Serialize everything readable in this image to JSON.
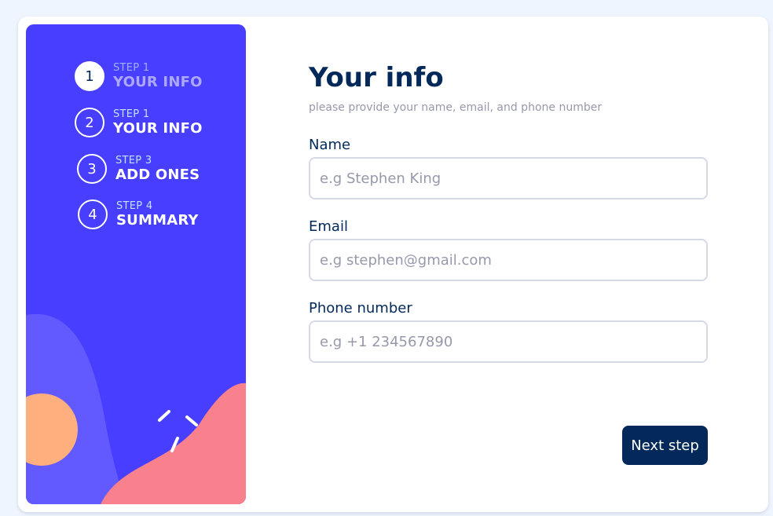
{
  "sidebar": {
    "steps": [
      {
        "number": "1",
        "label": "STEP 1",
        "title": "YOUR INFO"
      },
      {
        "number": "2",
        "label": "STEP 1",
        "title": "YOUR INFO"
      },
      {
        "number": "3",
        "label": "STEP 3",
        "title": "ADD ONES"
      },
      {
        "number": "4",
        "label": "STEP 4",
        "title": "SUMMARY"
      }
    ]
  },
  "form": {
    "title": "Your info",
    "subtitle": "please provide your name, email, and phone number",
    "fields": [
      {
        "label": "Name",
        "placeholder": "e.g Stephen King"
      },
      {
        "label": "Email",
        "placeholder": "e.g stephen@gmail.com"
      },
      {
        "label": "Phone number",
        "placeholder": "e.g +1 234567890"
      }
    ],
    "next_label": "Next step"
  },
  "colors": {
    "sidebar_bg": "#483eff",
    "primary": "#02295a",
    "border": "#d6d9e6",
    "muted": "#9699ab",
    "deco_purple": "#6259ff",
    "deco_orange": "#ffaf7e",
    "deco_pink": "#f9818e"
  }
}
